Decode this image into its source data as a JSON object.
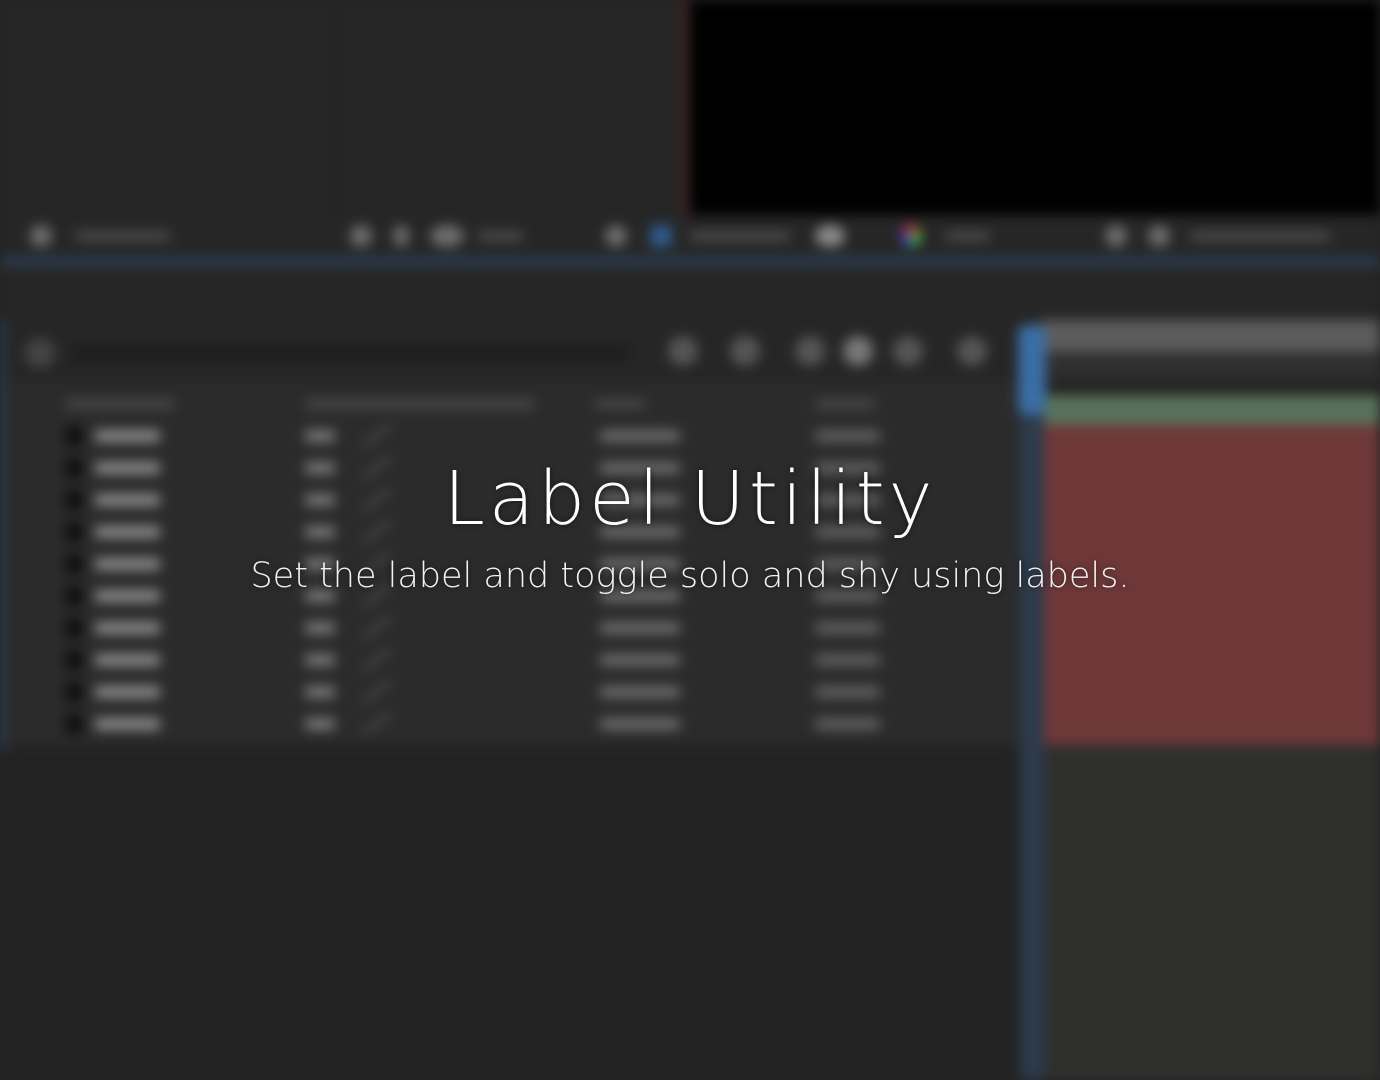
{
  "overlay": {
    "title": "Label Utility",
    "subtitle": "Set the label and toggle solo and shy using labels."
  },
  "colors": {
    "background": "#232323",
    "viewer": "#000000",
    "accent_blue": "#3a6ea5",
    "layer_bar_red": "#6e3838",
    "layer_bar_green": "#59715a",
    "title_text": "#ffffff"
  },
  "background_ui": {
    "description_icons": [
      "search-icon",
      "zoom-icon",
      "color-wheel-icon",
      "camera-icon",
      "mask-icon"
    ],
    "layer_row_count": 10
  }
}
